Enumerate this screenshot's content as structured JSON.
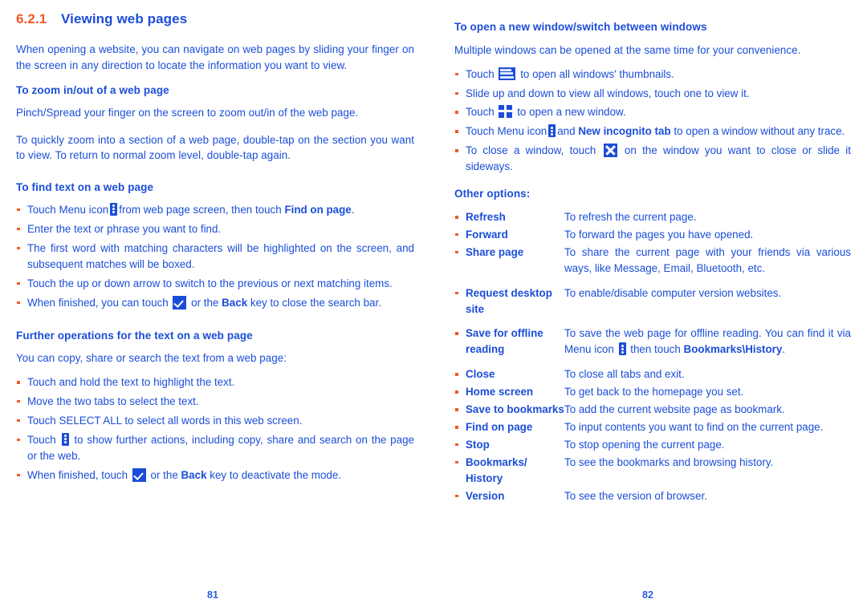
{
  "left": {
    "section_number": "6.2.1",
    "section_title": "Viewing web pages",
    "intro": "When opening a website, you can navigate on web pages by sliding your finger on the screen in any direction to locate the information you want to view.",
    "zoom_heading": "To zoom in/out of a web page",
    "zoom_p1": "Pinch/Spread your finger on the screen to zoom out/in of the web page.",
    "zoom_p2": "To quickly zoom into a section of a web page, double-tap on the section you want to view. To return to normal zoom level, double-tap again.",
    "find_heading": "To find text on a web page",
    "find_bullets": {
      "b1_pre": "Touch Menu icon",
      "b1_mid": "from web page screen, then touch",
      "b1_bold": "Find on page",
      "b1_post": ".",
      "b2": "Enter the text or phrase you want to find.",
      "b3": "The first word with matching characters will be highlighted on the screen, and subsequent matches will be boxed.",
      "b4": "Touch the up or down arrow to switch to the previous or next matching items.",
      "b5_pre": "When finished, you can touch",
      "b5_mid": "or the",
      "b5_bold": "Back",
      "b5_post": "key to close the search bar."
    },
    "further_heading": "Further operations for the text on a web page",
    "further_intro": "You can copy, share or search the text from a web page:",
    "further_bullets": {
      "f1": "Touch and hold the text to highlight the text.",
      "f2": "Move the two tabs to select the text.",
      "f3": "Touch SELECT ALL to select all words in this web screen.",
      "f4_pre": "Touch",
      "f4_post": "to show further actions, including copy, share and search on the page or the web.",
      "f5_pre": "When finished, touch",
      "f5_mid": "or the",
      "f5_bold": "Back",
      "f5_post": "key to deactivate the mode."
    },
    "page_number": "81"
  },
  "right": {
    "window_heading": "To open a new window/switch between windows",
    "window_intro": "Multiple windows can be opened at the same time for your convenience.",
    "window_bullets": {
      "w1_pre": "Touch",
      "w1_post": "to open all windows' thumbnails.",
      "w2": "Slide up and down to view all windows, touch one to view it.",
      "w3_pre": "Touch",
      "w3_post": "to open a new window.",
      "w4_pre": "Touch Menu icon",
      "w4_mid": "and",
      "w4_bold": "New incognito tab",
      "w4_post": "to open a window without any trace.",
      "w5_pre": "To close a window, touch",
      "w5_post": "on the window you want to close or slide it sideways."
    },
    "other_options_heading": "Other options:",
    "options": [
      {
        "term": "Refresh",
        "def": "To refresh the current page."
      },
      {
        "term": "Forward",
        "def": "To forward the pages you have opened."
      },
      {
        "term": "Share page",
        "def": "To share the current page with your friends via various ways, like Message, Email, Bluetooth, etc."
      },
      {
        "term": "Request desktop site",
        "def": "To enable/disable computer version websites."
      },
      {
        "term": "Save for offline reading",
        "def_pre": "To save the web page for offline reading. You can find it via Menu icon",
        "def_mid": "then touch",
        "def_bold": "Bookmarks\\History",
        "def_post": "."
      },
      {
        "term": "Close",
        "def": "To close all tabs and exit."
      },
      {
        "term": "Home screen",
        "def": "To get back to the homepage you set."
      },
      {
        "term": "Save to bookmarks",
        "def": "To add the current website page as bookmark."
      },
      {
        "term": "Find on page",
        "def": "To input contents you want to find on the current page."
      },
      {
        "term": "Stop",
        "def": "To stop opening the current page."
      },
      {
        "term": "Bookmarks/ History",
        "def": "To see the bookmarks and browsing history."
      },
      {
        "term": "Version",
        "def": "To see the version of browser."
      }
    ],
    "page_number": "82"
  },
  "colors": {
    "text_blue": "#1b4ed8",
    "accent_orange": "#f05a28",
    "icon_blue": "#1b4ed8",
    "background": "#ffffff"
  }
}
